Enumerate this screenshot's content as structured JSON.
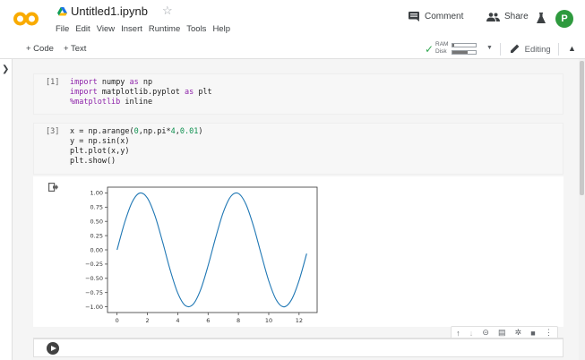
{
  "app": {
    "notebook_title": "Untitled1.ipynb",
    "star_icon": "☆",
    "menu": [
      "File",
      "Edit",
      "View",
      "Insert",
      "Runtime",
      "Tools",
      "Help"
    ],
    "comment_label": "Comment",
    "share_label": "Share",
    "avatar_letter": "P",
    "brand_color": "#f9ab00"
  },
  "toolbar": {
    "add_code": "+ Code",
    "add_text": "+ Text",
    "ram_label": "RAM",
    "disk_label": "Disk",
    "ram_usage": 0.08,
    "disk_usage": 0.65,
    "editing_label": "Editing"
  },
  "cells": [
    {
      "exec_count": "[1]",
      "lines": [
        [
          {
            "t": "import",
            "c": "kw"
          },
          {
            "t": " numpy ",
            "c": ""
          },
          {
            "t": "as",
            "c": "kw"
          },
          {
            "t": " np",
            "c": ""
          }
        ],
        [
          {
            "t": "import",
            "c": "kw"
          },
          {
            "t": " matplotlib.pyplot ",
            "c": ""
          },
          {
            "t": "as",
            "c": "kw"
          },
          {
            "t": " plt",
            "c": ""
          }
        ],
        [
          {
            "t": "%matplotlib",
            "c": "kw"
          },
          {
            "t": " inline",
            "c": ""
          }
        ]
      ]
    },
    {
      "exec_count": "[3]",
      "lines": [
        [
          {
            "t": "x = np.arange(",
            "c": ""
          },
          {
            "t": "0",
            "c": "num"
          },
          {
            "t": ",np.pi*",
            "c": ""
          },
          {
            "t": "4",
            "c": "num"
          },
          {
            "t": ",",
            "c": ""
          },
          {
            "t": "0.01",
            "c": "num"
          },
          {
            "t": ")",
            "c": ""
          }
        ],
        [
          {
            "t": "y = np.sin(x)",
            "c": ""
          }
        ],
        [
          {
            "t": "plt.plot(x,y)",
            "c": ""
          }
        ],
        [
          {
            "t": "plt.show()",
            "c": ""
          }
        ]
      ]
    }
  ],
  "chart_data": {
    "type": "line",
    "function": "sin",
    "x": [
      0,
      0.5,
      1,
      1.5,
      2,
      2.5,
      3,
      3.5,
      4,
      4.5,
      5,
      5.5,
      6,
      6.5,
      7,
      7.5,
      8,
      8.5,
      9,
      9.5,
      10,
      10.5,
      11,
      11.5,
      12,
      12.5
    ],
    "y": [
      0,
      0.479,
      0.841,
      0.997,
      0.909,
      0.598,
      0.141,
      -0.351,
      -0.757,
      -0.978,
      -0.959,
      -0.706,
      -0.279,
      0.215,
      0.657,
      0.938,
      0.989,
      0.798,
      0.412,
      -0.075,
      -0.544,
      -0.88,
      -1.0,
      -0.875,
      -0.537,
      -0.066
    ],
    "xlim": [
      -0.63,
      13.19
    ],
    "ylim": [
      -1.1,
      1.1
    ],
    "xticks": [
      0,
      2,
      4,
      6,
      8,
      10,
      12
    ],
    "yticks": [
      1.0,
      0.75,
      0.5,
      0.25,
      0.0,
      -0.25,
      -0.5,
      -0.75,
      -1.0
    ],
    "ytick_labels": [
      "1.00",
      "0.75",
      "0.50",
      "0.25",
      "0.00",
      "−0.25",
      "−0.50",
      "−0.75",
      "−1.00"
    ],
    "line_color": "#1f77b4",
    "grid": false
  }
}
